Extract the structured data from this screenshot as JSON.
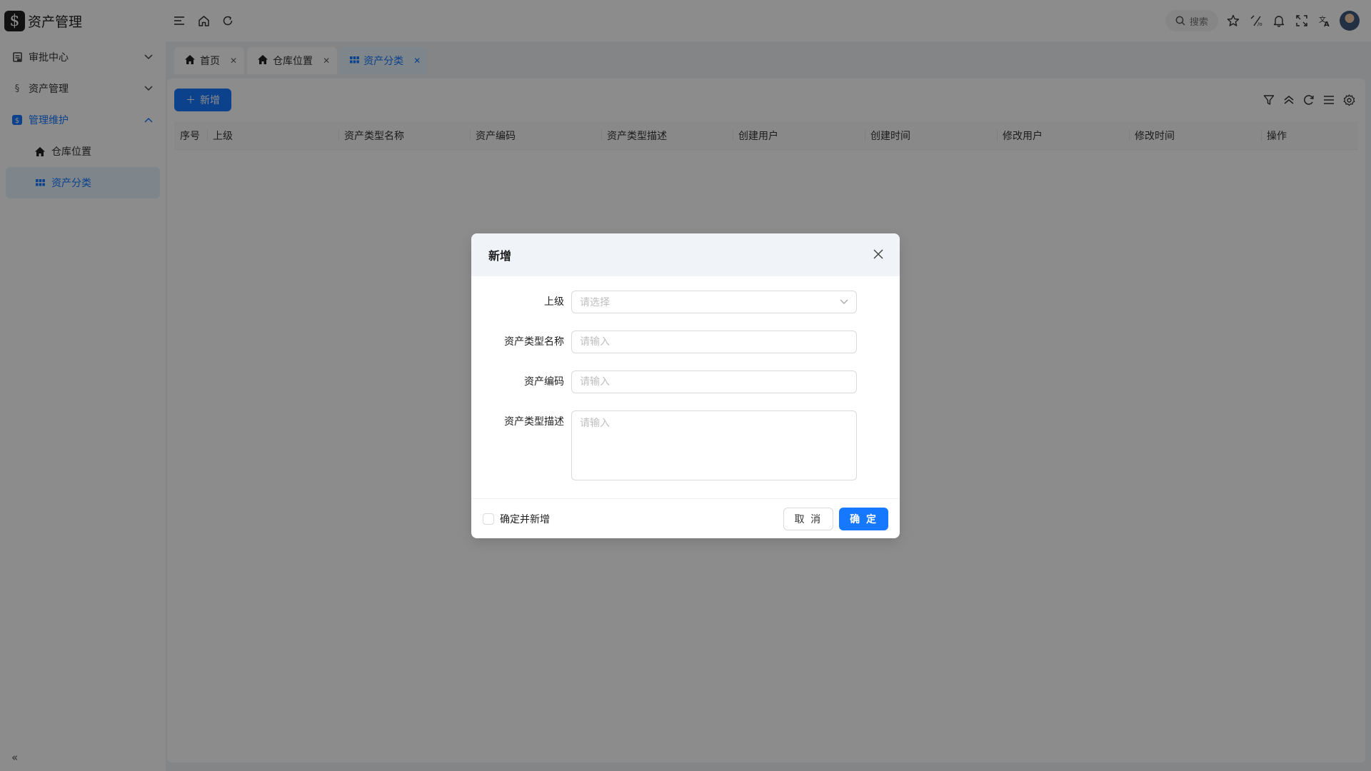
{
  "app": {
    "logo_symbol": "$",
    "title": "资产管理"
  },
  "sidebar": {
    "menu": [
      {
        "label": "审批中心"
      },
      {
        "label": "资产管理"
      },
      {
        "label": "管理维护"
      }
    ],
    "submenu": [
      {
        "label": "仓库位置"
      },
      {
        "label": "资产分类"
      }
    ],
    "collapse_label": "«"
  },
  "header": {
    "search_label": "搜索"
  },
  "tabs": [
    {
      "label": "首页"
    },
    {
      "label": "仓库位置"
    },
    {
      "label": "资产分类"
    }
  ],
  "toolbar": {
    "add_label": "新增"
  },
  "table": {
    "columns": [
      "序号",
      "上级",
      "资产类型名称",
      "资产编码",
      "资产类型描述",
      "创建用户",
      "创建时间",
      "修改用户",
      "修改时间",
      "操作"
    ]
  },
  "modal": {
    "title": "新增",
    "fields": {
      "parent": {
        "label": "上级",
        "placeholder": "请选择"
      },
      "type_name": {
        "label": "资产类型名称",
        "placeholder": "请输入"
      },
      "code": {
        "label": "资产编码",
        "placeholder": "请输入"
      },
      "description": {
        "label": "资产类型描述",
        "placeholder": "请输入"
      }
    },
    "confirm_and_add_label": "确定并新增",
    "cancel_label": "取 消",
    "ok_label": "确 定"
  },
  "colors": {
    "primary": "#1677ff",
    "mask": "rgba(0,0,0,0.45)"
  }
}
